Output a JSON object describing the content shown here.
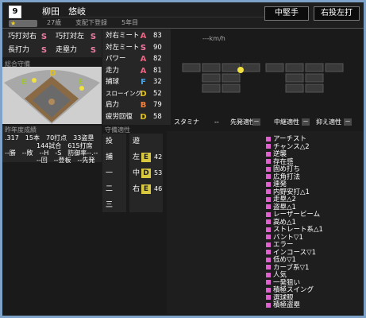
{
  "header": {
    "number": "9",
    "name": "柳田　悠岐",
    "age": "27歳",
    "status": "支配下登録",
    "years": "5年目",
    "position": "中堅手",
    "handed": "右投左打"
  },
  "left_skills": [
    {
      "label": "巧打対右",
      "grade": "S"
    },
    {
      "label": "巧打対左",
      "grade": "S"
    },
    {
      "label": "長打力",
      "grade": "S"
    },
    {
      "label": "走塁力",
      "grade": "S"
    }
  ],
  "field": {
    "label": "総合守備",
    "positions": [
      {
        "grade": "D"
      },
      {
        "grade": "E"
      },
      {
        "grade": "E"
      }
    ]
  },
  "season": {
    "label": "昨年度成績",
    "line1": ".317　15本　70打点　33盗塁",
    "line2": "144試合　615打席",
    "line3": "--勝　--敗　--H　-S　防御率--.--",
    "line4": "--回　--登板　--先発"
  },
  "main_stats": [
    {
      "label": "対右ミート",
      "grade": "A",
      "value": "83"
    },
    {
      "label": "対左ミート",
      "grade": "S",
      "value": "90"
    },
    {
      "label": "パワー",
      "grade": "A",
      "value": "82"
    },
    {
      "label": "走力",
      "grade": "A",
      "value": "81"
    },
    {
      "label": "捕球",
      "grade": "F",
      "value": "32"
    },
    {
      "label": "スローイング",
      "grade": "D",
      "value": "52"
    },
    {
      "label": "肩力",
      "grade": "B",
      "value": "79"
    },
    {
      "label": "疲労回復",
      "grade": "D",
      "value": "58"
    }
  ],
  "pitch": {
    "speed": "---km/h",
    "stamina_label": "スタミナ",
    "stamina_value": "--",
    "starter_label": "先発適性",
    "starter_value": "ー",
    "middle_label": "中継適性",
    "middle_value": "ー",
    "closer_label": "抑え適性",
    "closer_value": "ー"
  },
  "defense": {
    "label": "守備適性",
    "rows": [
      {
        "left": "投",
        "right": "遊",
        "right_grade": "",
        "right_value": ""
      },
      {
        "left": "捕",
        "right": "左",
        "right_grade": "E",
        "right_value": "42"
      },
      {
        "left": "一",
        "right": "中",
        "right_grade": "D",
        "right_value": "53"
      },
      {
        "left": "二",
        "right": "右",
        "right_grade": "E",
        "right_value": "46"
      },
      {
        "left": "三",
        "right": "",
        "right_grade": "",
        "right_value": ""
      }
    ]
  },
  "abilities": [
    "アーチスト",
    "チャンス△2",
    "逆襲",
    "存在感",
    "固め打ち",
    "広角打法",
    "連発",
    "内野安打△1",
    "走塁△2",
    "盗塁△1",
    "レーザービーム",
    "高め△1",
    "ストレート系△1",
    "バント▽1",
    "エラー",
    "インコース▽1",
    "低め▽1",
    "カーブ系▽1",
    "人気",
    "一発狙い",
    "積極スイング",
    "選球眼",
    "積極盗塁"
  ],
  "colors": {
    "grade_S": "#f07aa0",
    "grade_A": "#f06080",
    "grade_B": "#f08040",
    "grade_D": "#e0c020",
    "grade_E": "#a0c040",
    "grade_F": "#4aa0e0"
  }
}
